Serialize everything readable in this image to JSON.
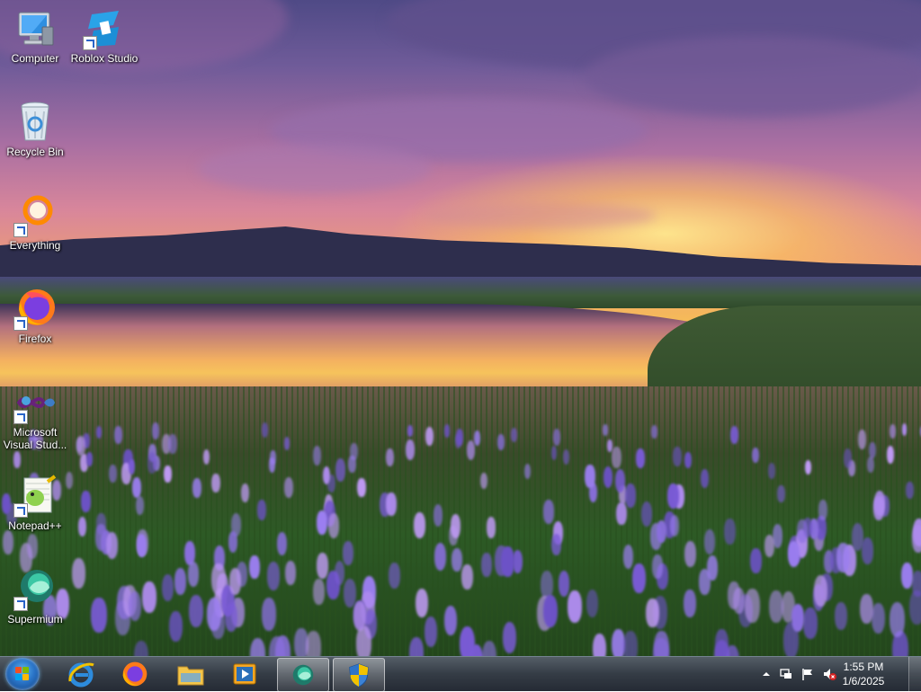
{
  "desktop": {
    "icons": [
      {
        "label": "Computer",
        "icon": "computer-icon",
        "shortcut": false
      },
      {
        "label": "Roblox Studio",
        "icon": "roblox-studio-icon",
        "shortcut": true
      },
      {
        "label": "Recycle Bin",
        "icon": "recycle-bin-icon",
        "shortcut": false
      },
      {
        "label": "Everything",
        "icon": "everything-search-icon",
        "shortcut": true
      },
      {
        "label": "Firefox",
        "icon": "firefox-icon",
        "shortcut": true
      },
      {
        "label": "Microsoft Visual Stud...",
        "icon": "visual-studio-icon",
        "shortcut": true
      },
      {
        "label": "Notepad++",
        "icon": "notepad-plus-plus-icon",
        "shortcut": true
      },
      {
        "label": "Supermium",
        "icon": "supermium-icon",
        "shortcut": true
      }
    ]
  },
  "taskbar": {
    "start_icon": "windows-start-orb",
    "pinned": [
      {
        "icon": "internet-explorer-icon",
        "active": false
      },
      {
        "icon": "firefox-icon",
        "active": false
      },
      {
        "icon": "file-explorer-icon",
        "active": false
      },
      {
        "icon": "media-player-icon",
        "active": false
      },
      {
        "icon": "supermium-icon",
        "active": true
      },
      {
        "icon": "security-shield-icon",
        "active": true
      }
    ],
    "tray": {
      "icons": [
        "show-hidden-icons-arrow",
        "network-icon",
        "action-center-flag-icon",
        "volume-muted-icon"
      ],
      "time": "1:55 PM",
      "date": "1/6/2025"
    }
  },
  "colors": {
    "accent": "#2a74c7",
    "taskbar": "#28303a",
    "label_text": "#ffffff"
  }
}
